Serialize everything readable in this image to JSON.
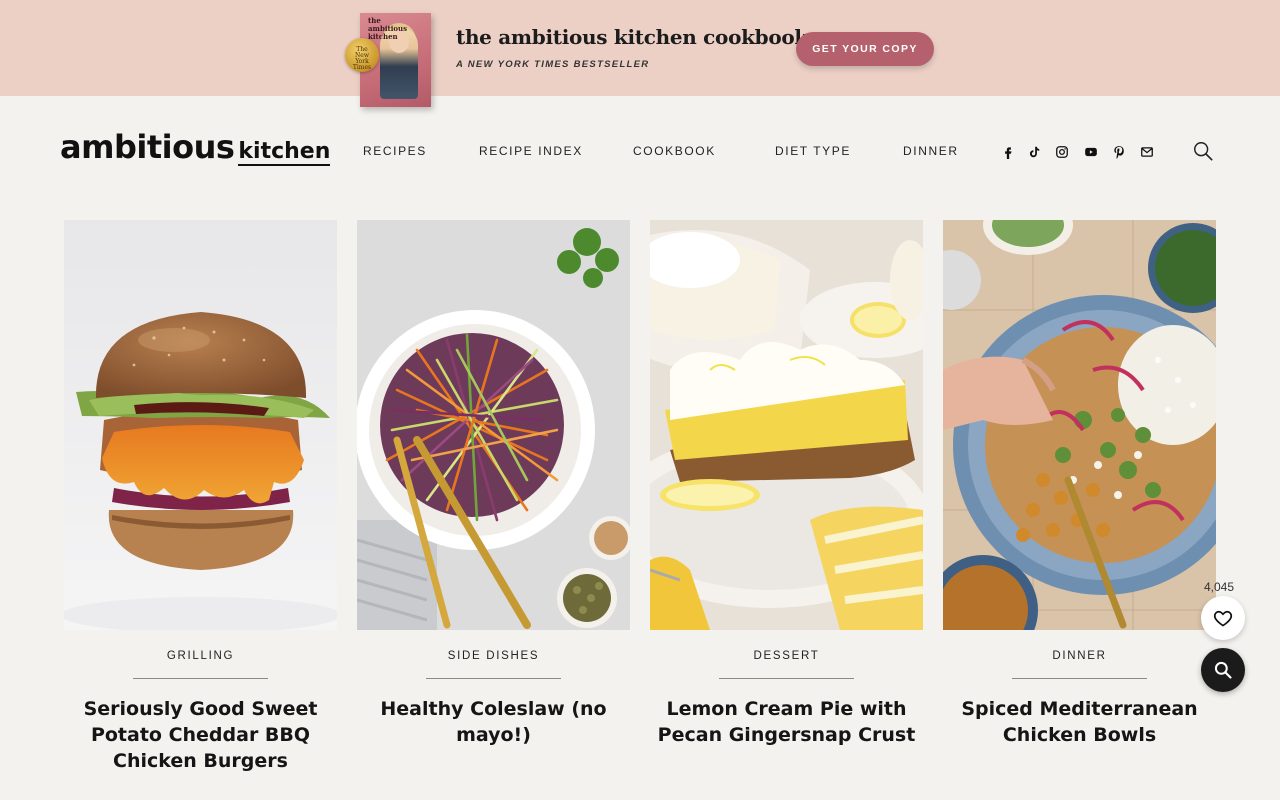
{
  "promo": {
    "book_cover_title": "the ambitious kitchen",
    "seal_text": "The New York Times",
    "title": "the ambitious kitchen cookbook",
    "subtitle": "A NEW YORK TIMES BESTSELLER",
    "button_label": "GET YOUR COPY",
    "background_color": "#ecd0c6",
    "button_color": "#b5606d"
  },
  "header": {
    "logo_main": "ambitious",
    "logo_sub": "kitchen",
    "nav": [
      "RECIPES",
      "RECIPE INDEX",
      "COOKBOOK",
      "DIET TYPE",
      "DINNER"
    ],
    "social_icons": [
      "facebook-icon",
      "tiktok-icon",
      "instagram-icon",
      "youtube-icon",
      "pinterest-icon",
      "email-icon"
    ],
    "search_icon": "search-icon"
  },
  "cards": [
    {
      "category": "GRILLING",
      "title": "Seriously Good Sweet Potato Cheddar BBQ Chicken Burgers",
      "image": "burger-photo"
    },
    {
      "category": "SIDE DISHES",
      "title": "Healthy Coleslaw (no mayo!)",
      "image": "coleslaw-photo"
    },
    {
      "category": "DESSERT",
      "title": "Lemon Cream Pie with Pecan Gingersnap Crust",
      "image": "lemon-pie-photo"
    },
    {
      "category": "DINNER",
      "title": "Spiced Mediterranean Chicken Bowls",
      "image": "mediterranean-bowl-photo"
    }
  ],
  "floating": {
    "favorites_count": "4,045",
    "favorite_icon": "heart-icon",
    "search_icon": "search-icon"
  }
}
